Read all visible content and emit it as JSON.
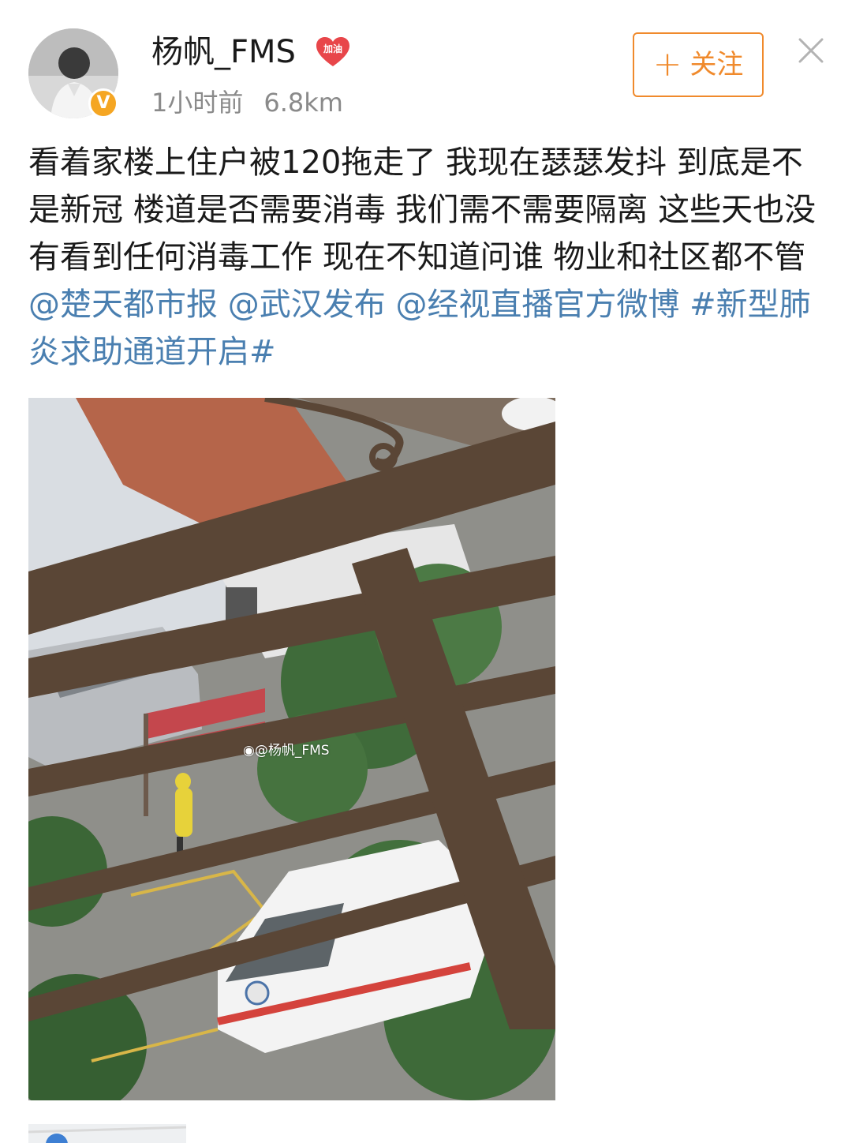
{
  "post": {
    "username": "杨帆_FMS",
    "badge_text": "加油",
    "verified_mark": "V",
    "time": "1小时前",
    "distance": "6.8km",
    "follow_label": "关注",
    "follow_plus": "+",
    "content": {
      "text": "看着家楼上住户被120拖走了 我现在瑟瑟发抖 到底是不是新冠 楼道是否需要消毒 我们需不需要隔离 这些天也没有看到任何消毒工作 现在不知道问谁 物业和社区都不管",
      "mentions": [
        "@楚天都市报",
        "@武汉发布",
        "@经视直播官方微博"
      ],
      "topic": "#新型肺炎求助通道开启#"
    },
    "photo": {
      "watermark": "@杨帆_FMS"
    }
  },
  "colors": {
    "accent": "#f08a2c",
    "link": "#4a7fb0",
    "badge": "#e8464a",
    "verified": "#f5a623",
    "meta_text": "#8a8a8a"
  },
  "icons": {
    "follow": "plus-icon",
    "close": "close-icon",
    "verified": "verified-badge-icon",
    "badge": "heart-badge-icon",
    "watermark": "weibo-logo-icon",
    "location": "location-pin-icon"
  }
}
